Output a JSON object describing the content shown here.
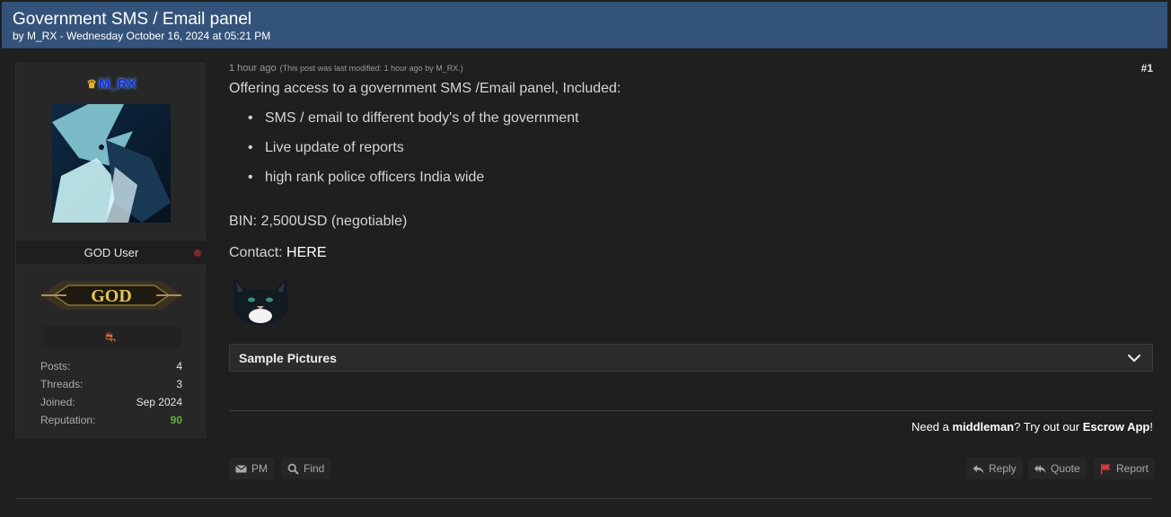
{
  "thread": {
    "title": "Government SMS / Email panel",
    "byline": "by M_RX - Wednesday October 16, 2024 at 05:21 PM"
  },
  "user": {
    "name": "M_RX",
    "title": "GOD User",
    "badge_text": "GOD",
    "stats": [
      {
        "label": "Posts:",
        "value": "4"
      },
      {
        "label": "Threads:",
        "value": "3"
      },
      {
        "label": "Joined:",
        "value": "Sep 2024"
      },
      {
        "label": "Reputation:",
        "value": "90"
      }
    ]
  },
  "post": {
    "time": "1 hour ago",
    "modified": "(This post was last modified: 1 hour ago by M_RX.)",
    "number": "#1",
    "intro": "Offering access to a government SMS /Email panel, Included:",
    "bullets": [
      "SMS / email to different body's of the government",
      "Live update of reports",
      "high rank police officers India wide"
    ],
    "bin": "BIN: 2,500USD (negotiable)",
    "contact_label": "Contact: ",
    "contact_link": "HERE",
    "spoiler_label": "Sample Pictures"
  },
  "escrow": {
    "pre": "Need a ",
    "middleman": "middleman",
    "mid": "? Try out our ",
    "app": "Escrow App",
    "post": "!"
  },
  "actions": {
    "pm": "PM",
    "find": "Find",
    "reply": "Reply",
    "quote": "Quote",
    "report": "Report"
  },
  "colors": {
    "header_bg": "#34537a",
    "username": "#1c2fd6",
    "reputation": "#5fb13b",
    "report_icon": "#d23a3a"
  }
}
